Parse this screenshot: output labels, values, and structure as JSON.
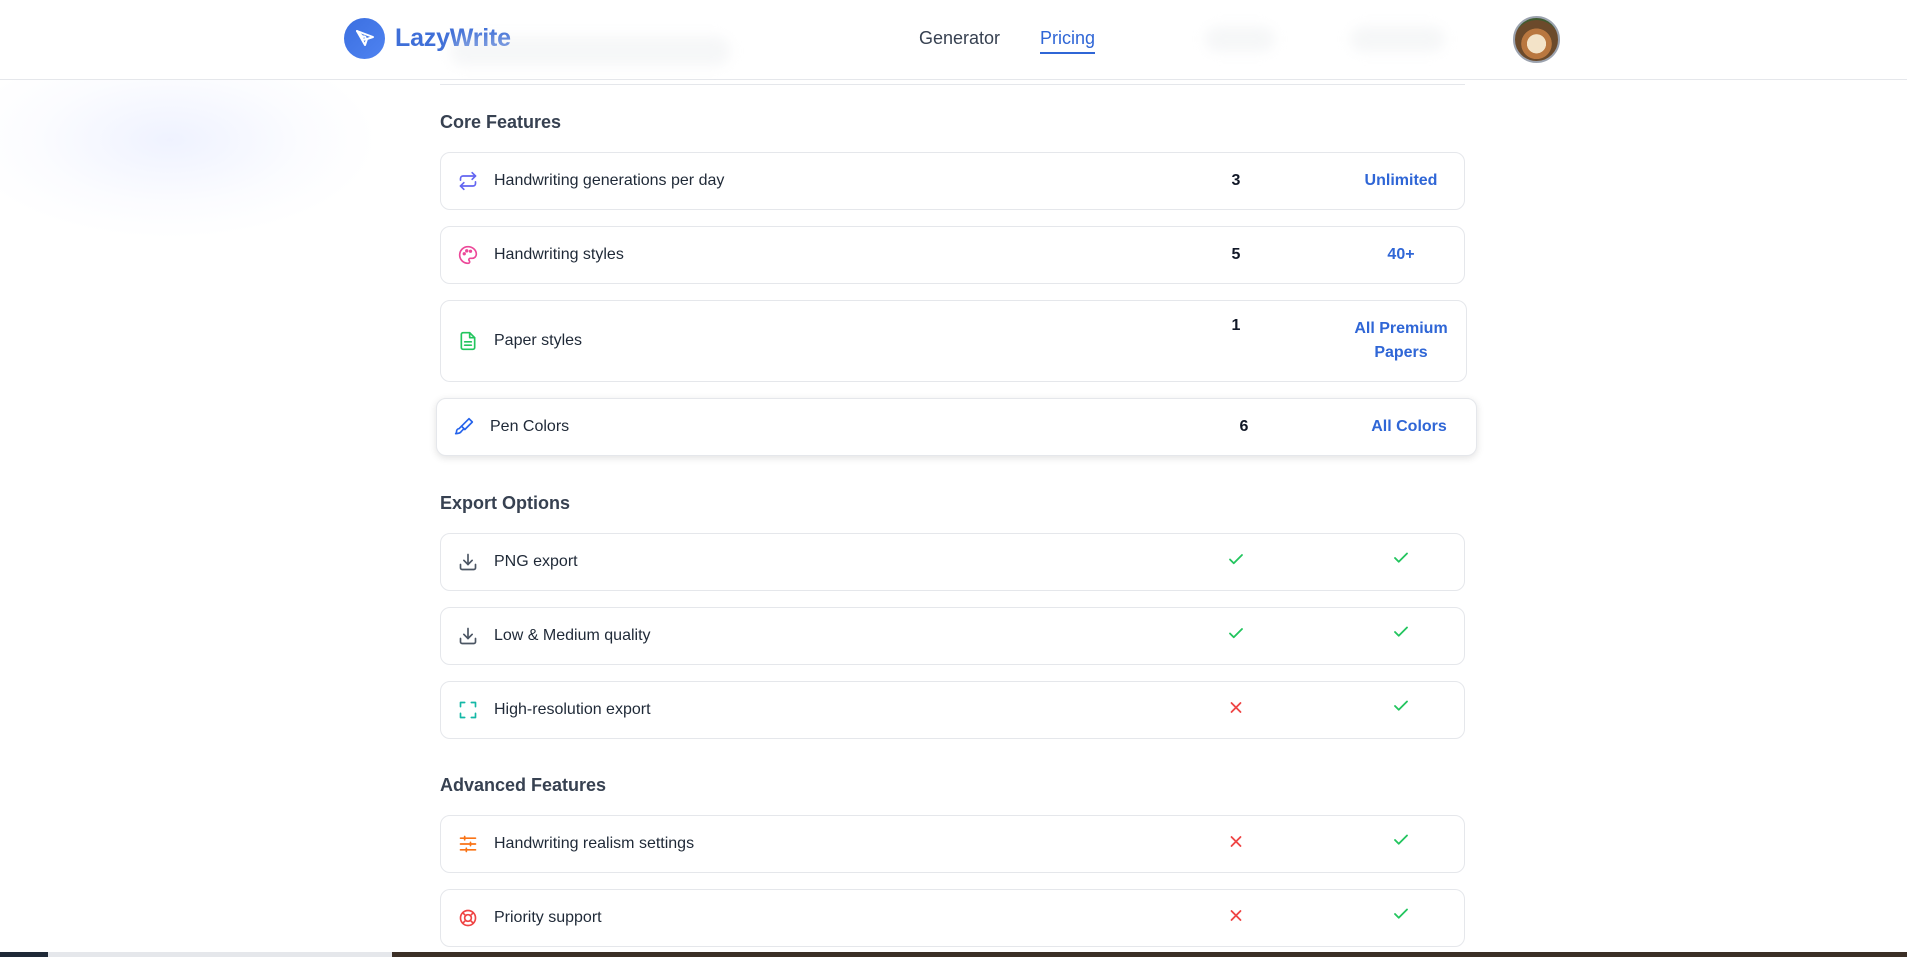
{
  "header": {
    "brand": "LazyWrite",
    "nav": [
      {
        "label": "Generator",
        "active": false
      },
      {
        "label": "Pricing",
        "active": true
      }
    ]
  },
  "colors": {
    "brand": "#3f6fd8",
    "accent": "#2f66d6",
    "check": "#22c55e",
    "cross": "#ef4444"
  },
  "sections": {
    "core": {
      "title": "Core Features",
      "rows": [
        {
          "icon": "repeat-icon",
          "label": "Handwriting generations per day",
          "free": "3",
          "pro": "Unlimited"
        },
        {
          "icon": "palette-icon",
          "label": "Handwriting styles",
          "free": "5",
          "pro": "40+"
        },
        {
          "icon": "document-icon",
          "label": "Paper styles",
          "free": "1",
          "pro": "All Premium Papers"
        },
        {
          "icon": "brush-icon",
          "label": "Pen Colors",
          "free": "6",
          "pro": "All Colors"
        }
      ]
    },
    "export": {
      "title": "Export Options",
      "rows": [
        {
          "icon": "download-icon",
          "label": "PNG export",
          "free": "check",
          "pro": "check"
        },
        {
          "icon": "download-icon",
          "label": "Low & Medium quality",
          "free": "check",
          "pro": "check"
        },
        {
          "icon": "expand-icon",
          "label": "High-resolution export",
          "free": "cross",
          "pro": "check"
        }
      ]
    },
    "advanced": {
      "title": "Advanced Features",
      "rows": [
        {
          "icon": "sliders-icon",
          "label": "Handwriting realism settings",
          "free": "cross",
          "pro": "check"
        },
        {
          "icon": "lifebuoy-icon",
          "label": "Priority support",
          "free": "cross",
          "pro": "check"
        }
      ]
    }
  }
}
